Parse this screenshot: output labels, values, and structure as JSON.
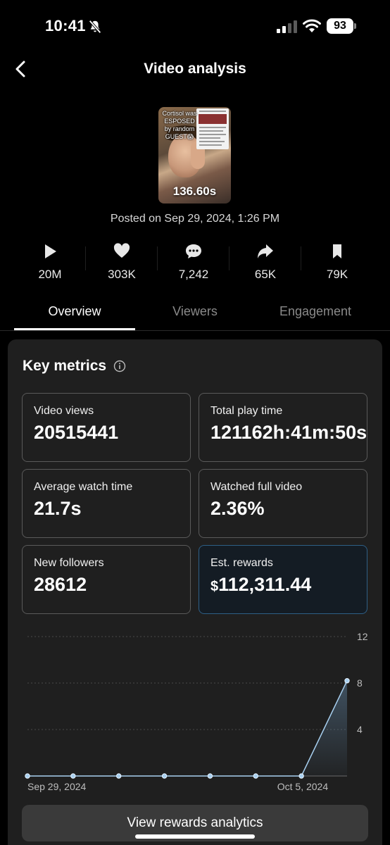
{
  "status_bar": {
    "time": "10:41",
    "battery": "93"
  },
  "header": {
    "title": "Video analysis"
  },
  "video": {
    "thumbnail_caption": "Cortisol was ESPOSED by random GUEST😱",
    "duration": "136.60s",
    "posted": "Posted on Sep 29, 2024, 1:26 PM"
  },
  "stats": [
    {
      "icon": "play-icon",
      "value": "20M"
    },
    {
      "icon": "heart-icon",
      "value": "303K"
    },
    {
      "icon": "comment-icon",
      "value": "7,242"
    },
    {
      "icon": "share-icon",
      "value": "65K"
    },
    {
      "icon": "bookmark-icon",
      "value": "79K"
    }
  ],
  "tabs": [
    "Overview",
    "Viewers",
    "Engagement"
  ],
  "key_metrics": {
    "title": "Key metrics",
    "items": [
      {
        "label": "Video views",
        "value": "20515441"
      },
      {
        "label": "Total play time",
        "value": "121162h:41m:50s"
      },
      {
        "label": "Average watch time",
        "value": "21.7s"
      },
      {
        "label": "Watched full video",
        "value": "2.36%"
      },
      {
        "label": "New followers",
        "value": "28612"
      },
      {
        "label": "Est. rewards",
        "currency": "$",
        "value": "112,311.44"
      }
    ]
  },
  "chart_data": {
    "type": "area",
    "x": [
      "Sep 29, 2024",
      "Sep 30, 2024",
      "Oct 1, 2024",
      "Oct 2, 2024",
      "Oct 3, 2024",
      "Oct 4, 2024",
      "Oct 5, 2024",
      "Oct 6, 2024"
    ],
    "values": [
      0,
      0,
      0,
      0,
      0,
      0,
      0,
      8.2
    ],
    "x_tick_labels": [
      "Sep 29, 2024",
      "Oct 5, 2024"
    ],
    "y_ticks": [
      "12",
      "8",
      "4"
    ],
    "ylim": [
      0,
      12
    ],
    "grid": true,
    "line_color": "#a8d0f0"
  },
  "cta": {
    "label": "View rewards analytics"
  },
  "colors": {
    "accent_border": "#2e5f86",
    "card_bg": "#1f1f1f"
  }
}
